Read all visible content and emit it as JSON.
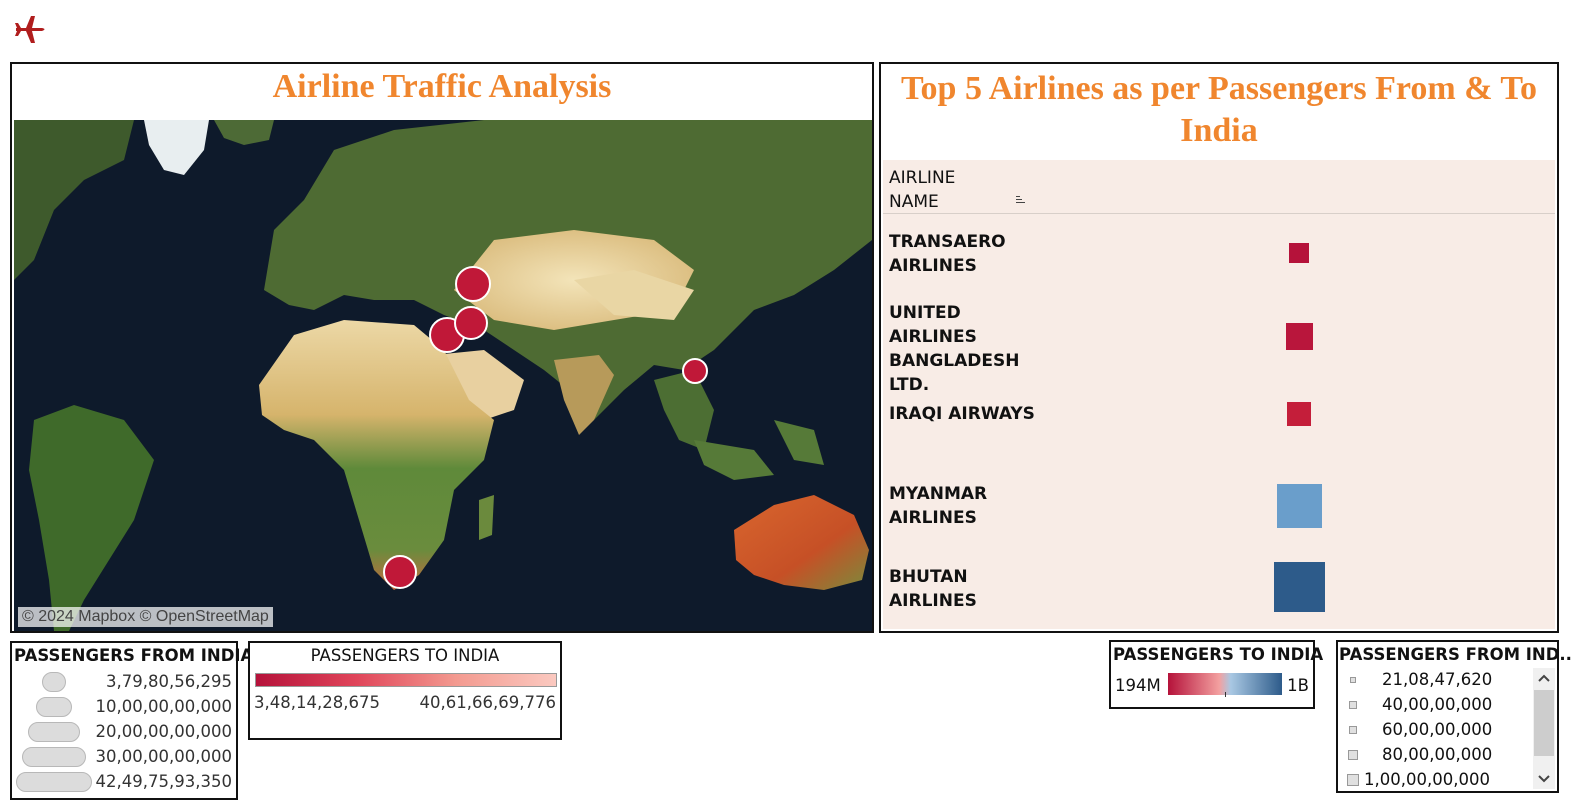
{
  "colors": {
    "title_orange": "#f0862e",
    "red_dark": "#b5123a",
    "blue_dark": "#2d5b8a",
    "blue_light": "#6a9ecb",
    "panel_bg": "#f8ece6"
  },
  "header": {
    "icon": "airplane-icon"
  },
  "map_panel": {
    "title": "Airline Traffic Analysis",
    "attribution": "© 2024 Mapbox © OpenStreetMap",
    "markers": [
      {
        "place": "Black Sea region",
        "passengers_from_india_level": "large"
      },
      {
        "place": "Eastern Mediterranean",
        "passengers_from_india_level": "large"
      },
      {
        "place": "Middle East",
        "passengers_from_india_level": "large"
      },
      {
        "place": "Southeast Asia",
        "passengers_from_india_level": "small"
      },
      {
        "place": "South Africa",
        "passengers_from_india_level": "large"
      }
    ]
  },
  "right_panel": {
    "title": "Top 5 Airlines as per Passengers From & To India",
    "column_header_line1": "AIRLINE",
    "column_header_line2": "NAME",
    "rows": [
      {
        "line1": "TRANSAERO",
        "line2": "AIRLINES",
        "line3": "",
        "color": "#b5123a"
      },
      {
        "line1": "UNITED AIRLINES",
        "line2": "BANGLADESH",
        "line3": "LTD.",
        "color": "#b9163c"
      },
      {
        "line1": "IRAQI AIRWAYS",
        "line2": "",
        "line3": "",
        "color": "#c41e3a"
      },
      {
        "line1": "MYANMAR",
        "line2": "AIRLINES",
        "line3": "",
        "color": "#6a9ecb"
      },
      {
        "line1": "BHUTAN",
        "line2": "AIRLINES",
        "line3": "",
        "color": "#2d5b8a"
      }
    ]
  },
  "legend_from_india_size": {
    "title": "PASSENGERS FROM INDIA",
    "items": [
      "3,79,80,56,295",
      "10,00,00,00,000",
      "20,00,00,00,000",
      "30,00,00,00,000",
      "42,49,75,93,350"
    ]
  },
  "legend_to_india_color": {
    "title": "PASSENGERS TO INDIA",
    "min_label": "3,48,14,28,675",
    "max_label": "40,61,66,69,776"
  },
  "legend_to_india_diverging": {
    "title": "PASSENGERS TO INDIA",
    "min_label": "194M",
    "max_label": "1B"
  },
  "legend_from_india_small": {
    "title": "PASSENGERS FROM IND..",
    "items": [
      "21,08,47,620",
      "40,00,00,000",
      "60,00,00,000",
      "80,00,00,000",
      "1,00,00,00,000"
    ]
  }
}
